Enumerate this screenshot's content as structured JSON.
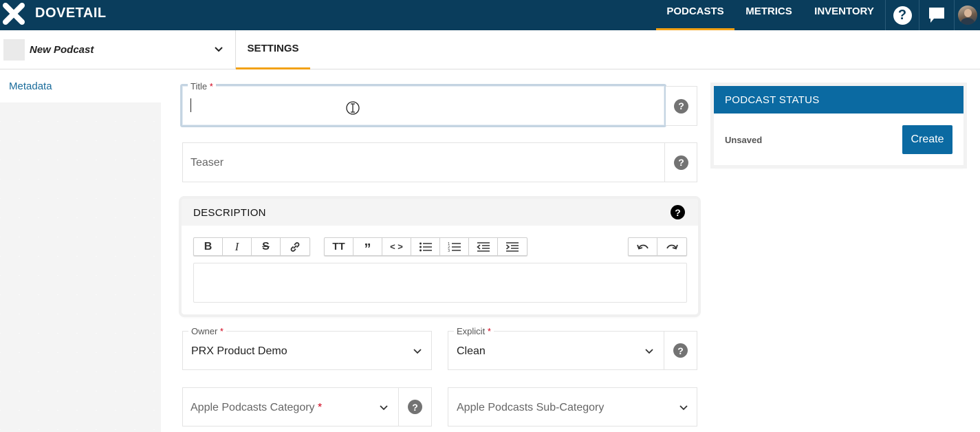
{
  "app": {
    "brand": "DOVETAIL"
  },
  "nav": {
    "items": [
      {
        "label": "PODCASTS",
        "active": true
      },
      {
        "label": "METRICS",
        "active": false
      },
      {
        "label": "INVENTORY",
        "active": false
      }
    ],
    "help_glyph": "?",
    "feedback_glyph": "!"
  },
  "subbar": {
    "podcast_name": "New Podcast",
    "tab_label": "SETTINGS"
  },
  "sidebar": {
    "items": [
      {
        "label": "Metadata"
      }
    ]
  },
  "form": {
    "title": {
      "label": "Title",
      "value": ""
    },
    "teaser": {
      "placeholder": "Teaser"
    },
    "description": {
      "heading": "DESCRIPTION",
      "toolbar": {
        "group1": [
          "bold",
          "italic",
          "strikethrough",
          "link"
        ],
        "group2": [
          "heading",
          "blockquote",
          "code",
          "bullet-list",
          "ordered-list",
          "outdent",
          "indent"
        ],
        "group3": [
          "undo",
          "redo"
        ]
      },
      "value": ""
    },
    "owner": {
      "label": "Owner",
      "value": "PRX Product Demo"
    },
    "explicit": {
      "label": "Explicit",
      "value": "Clean"
    },
    "category": {
      "placeholder": "Apple Podcasts Category"
    },
    "subcategory": {
      "placeholder": "Apple Podcasts Sub-Category"
    },
    "required_marker": "*",
    "help_glyph": "?"
  },
  "status": {
    "heading": "PODCAST STATUS",
    "state": "Unsaved",
    "create_label": "Create"
  },
  "colors": {
    "nav_bg": "#0a3d5c",
    "accent_orange": "#f2a115",
    "primary_blue": "#0b6aa2",
    "link_blue": "#1a6c9b",
    "required_red": "#d0021b"
  }
}
